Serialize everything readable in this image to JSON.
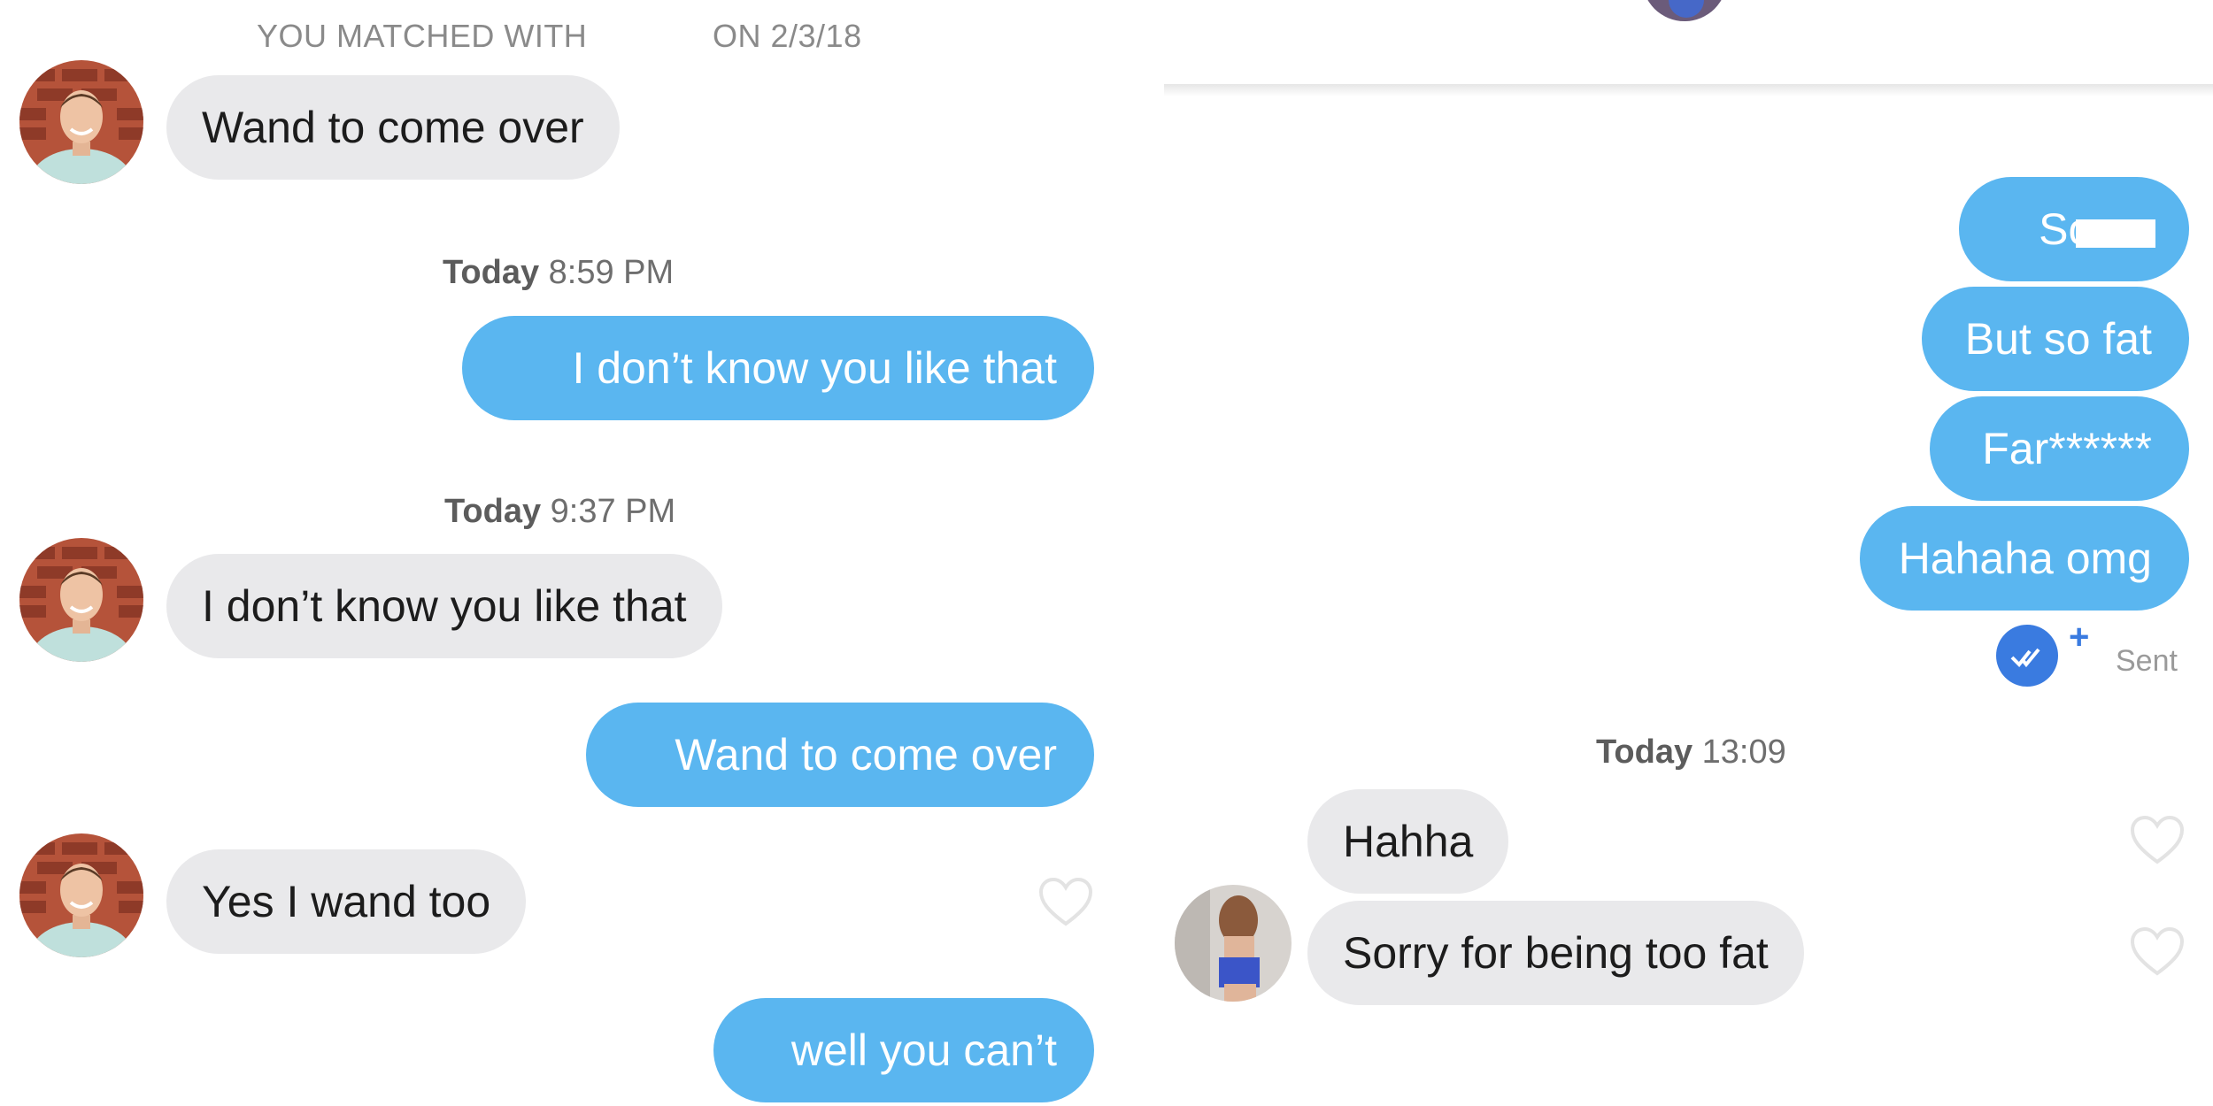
{
  "left": {
    "match_label": "YOU MATCHED WITH",
    "match_date": "ON 2/3/18",
    "messages": [
      {
        "text": "Wand to come over"
      },
      {
        "stamp_day": "Today",
        "stamp_time": "8:59 PM"
      },
      {
        "text": "I don’t know you like that"
      },
      {
        "stamp_day": "Today",
        "stamp_time": "9:37 PM"
      },
      {
        "text": "I don’t know you like that"
      },
      {
        "text": "Wand to come over"
      },
      {
        "text": "Yes I wand too"
      },
      {
        "text": "well you can’t"
      }
    ]
  },
  "right": {
    "messages": [
      {
        "text": "So se"
      },
      {
        "text": "But so fat"
      },
      {
        "text": "Far******"
      },
      {
        "text": "Hahaha omg"
      }
    ],
    "status": {
      "plus": "+",
      "label": "Sent"
    },
    "stamp": {
      "day": "Today",
      "time": "13:09"
    },
    "replies": [
      {
        "text": "Hahha"
      },
      {
        "text": "Sorry for being too fat"
      }
    ]
  },
  "colors": {
    "outgoing_bubble": "#5ab6f0",
    "incoming_bubble": "#e9e9eb",
    "read_badge": "#3a7be0"
  },
  "icons": [
    "heart-icon",
    "read-receipt-icon",
    "avatar"
  ]
}
